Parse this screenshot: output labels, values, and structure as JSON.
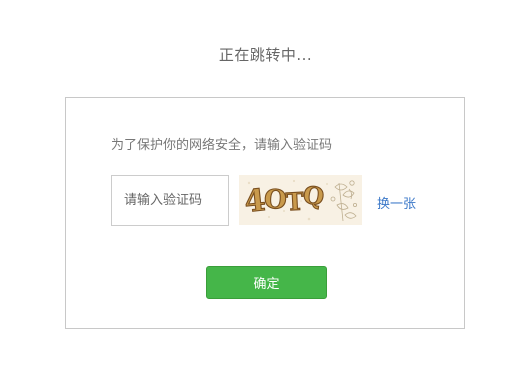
{
  "page": {
    "redirect_title": "正在跳转中..."
  },
  "verify": {
    "prompt": "为了保护你的网络安全，请输入验证码",
    "input_placeholder": "请输入验证码",
    "input_value": "",
    "captcha_text": "4OTQ",
    "refresh_label": "换一张",
    "confirm_label": "确定"
  },
  "colors": {
    "accent_green": "#45b649",
    "link_blue": "#3b78c8",
    "border_gray": "#c8c8c8"
  },
  "icons": {
    "captcha": "captcha-image"
  }
}
